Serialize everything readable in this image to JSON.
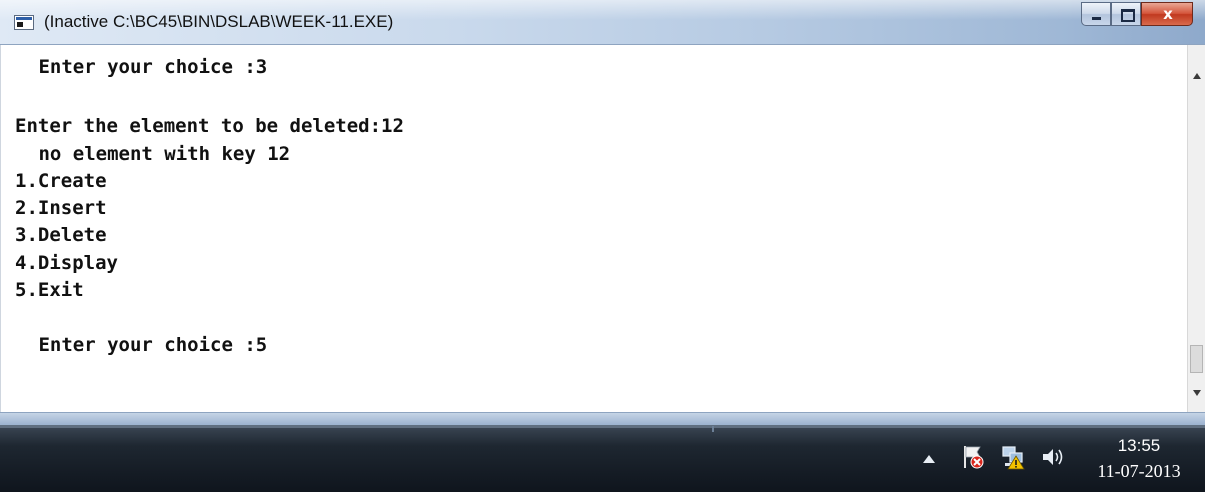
{
  "window": {
    "title": "(Inactive C:\\BC45\\BIN\\DSLAB\\WEEK-11.EXE)",
    "close_glyph": "x"
  },
  "console": {
    "lines": [
      " Enter your choice :3",
      "",
      "Enter the element to be deleted:12",
      " no element with key 12",
      "1.Create",
      "2.Insert",
      "3.Delete",
      "4.Display",
      "5.Exit",
      "",
      " Enter your choice :5"
    ]
  },
  "taskbar": {
    "tray_icons": [
      "show-hidden-icons-arrow",
      "action-center-flag-icon",
      "network-icon",
      "volume-icon"
    ],
    "clock": {
      "time": "13:55",
      "date": "11-07-2013"
    }
  },
  "colors": {
    "titlebar_start": "#dfe9f5",
    "titlebar_end": "#8ea9cb",
    "close_button": "#c0391f",
    "console_background": "#ffffff",
    "console_text": "#111111",
    "taskbar": "#151c25"
  }
}
